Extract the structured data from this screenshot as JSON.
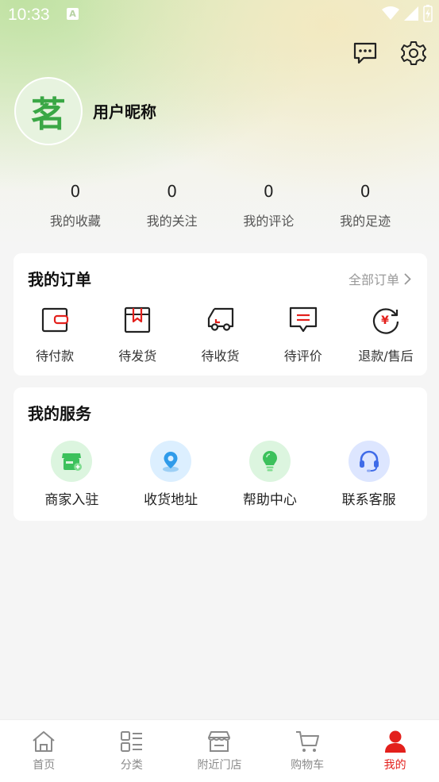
{
  "status_bar": {
    "time": "10:33",
    "notification_glyph": "A"
  },
  "profile": {
    "avatar_text": "茗",
    "nickname": "用户昵称"
  },
  "stats": [
    {
      "value": "0",
      "label": "我的收藏"
    },
    {
      "value": "0",
      "label": "我的关注"
    },
    {
      "value": "0",
      "label": "我的评论"
    },
    {
      "value": "0",
      "label": "我的足迹"
    }
  ],
  "orders": {
    "title": "我的订单",
    "all_label": "全部订单",
    "items": [
      {
        "label": "待付款",
        "icon": "wallet-icon"
      },
      {
        "label": "待发货",
        "icon": "box-icon"
      },
      {
        "label": "待收货",
        "icon": "truck-icon"
      },
      {
        "label": "待评价",
        "icon": "comment-icon"
      },
      {
        "label": "退款/售后",
        "icon": "refund-icon"
      }
    ]
  },
  "services": {
    "title": "我的服务",
    "items": [
      {
        "label": "商家入驻",
        "icon": "store-icon",
        "color": "#3cc15c"
      },
      {
        "label": "收货地址",
        "icon": "location-icon",
        "color": "#2f9bea"
      },
      {
        "label": "帮助中心",
        "icon": "lightbulb-icon",
        "color": "#3cc15c"
      },
      {
        "label": "联系客服",
        "icon": "headset-icon",
        "color": "#3f6be8"
      }
    ]
  },
  "tabbar": [
    {
      "label": "首页",
      "icon": "home-icon"
    },
    {
      "label": "分类",
      "icon": "category-icon"
    },
    {
      "label": "附近门店",
      "icon": "shop-icon"
    },
    {
      "label": "购物车",
      "icon": "cart-icon"
    },
    {
      "label": "我的",
      "icon": "user-icon",
      "active": true
    }
  ],
  "colors": {
    "accent": "#e3201c",
    "avatar_green": "#3aa745"
  }
}
